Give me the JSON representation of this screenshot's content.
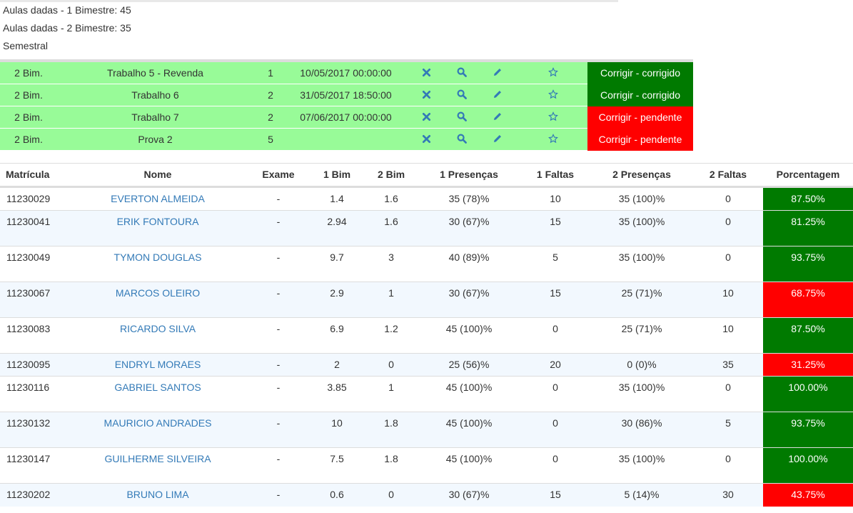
{
  "summary": {
    "line1": "Aulas dadas - 1 Bimestre: 45",
    "line2": "Aulas dadas - 2 Bimestre: 35",
    "line3": "Semestral"
  },
  "colors": {
    "activity_row_bg": "#98fb98",
    "status_ok": "#007a00",
    "status_pending": "#ff0000",
    "link": "#337ab7",
    "icon": "#337ab7"
  },
  "activities": [
    {
      "bimestre": "2 Bim.",
      "name": "Trabalho 5 - Revenda",
      "weight": "1",
      "date": "10/05/2017 00:00:00",
      "status": "Corrigir - corrigido",
      "status_type": "ok"
    },
    {
      "bimestre": "2 Bim.",
      "name": "Trabalho 6",
      "weight": "2",
      "date": "31/05/2017 18:50:00",
      "status": "Corrigir - corrigido",
      "status_type": "ok"
    },
    {
      "bimestre": "2 Bim.",
      "name": "Trabalho 7",
      "weight": "2",
      "date": "07/06/2017 00:00:00",
      "status": "Corrigir - pendente",
      "status_type": "pending"
    },
    {
      "bimestre": "2 Bim.",
      "name": "Prova 2",
      "weight": "5",
      "date": "",
      "status": "Corrigir - pendente",
      "status_type": "pending"
    }
  ],
  "activity_icons": [
    "close-icon",
    "search-icon",
    "pencil-icon",
    "star-icon"
  ],
  "students_table": {
    "headers": [
      "Matrícula",
      "Nome",
      "Exame",
      "1 Bim",
      "2 Bim",
      "1 Presenças",
      "1 Faltas",
      "2 Presenças",
      "2 Faltas",
      "Porcentagem"
    ],
    "rows": [
      {
        "matricula": "11230029",
        "nome": "EVERTON ALMEIDA",
        "exame": "-",
        "bim1": "1.4",
        "bim2": "1.6",
        "pres1": "35 (78)%",
        "faltas1": "10",
        "pres2": "35 (100)%",
        "faltas2": "0",
        "porcentagem": "87.50%",
        "status": "good"
      },
      {
        "matricula": "11230041",
        "nome": "ERIK FONTOURA",
        "exame": "-",
        "bim1": "2.94",
        "bim2": "1.6",
        "pres1": "30 (67)%",
        "faltas1": "15",
        "pres2": "35 (100)%",
        "faltas2": "0",
        "porcentagem": "81.25%",
        "status": "good"
      },
      {
        "matricula": "11230049",
        "nome": "TYMON DOUGLAS",
        "exame": "-",
        "bim1": "9.7",
        "bim2": "3",
        "pres1": "40 (89)%",
        "faltas1": "5",
        "pres2": "35 (100)%",
        "faltas2": "0",
        "porcentagem": "93.75%",
        "status": "good"
      },
      {
        "matricula": "11230067",
        "nome": "MARCOS OLEIRO",
        "exame": "-",
        "bim1": "2.9",
        "bim2": "1",
        "pres1": "30 (67)%",
        "faltas1": "15",
        "pres2": "25 (71)%",
        "faltas2": "10",
        "porcentagem": "68.75%",
        "status": "bad"
      },
      {
        "matricula": "11230083",
        "nome": "RICARDO SILVA",
        "exame": "-",
        "bim1": "6.9",
        "bim2": "1.2",
        "pres1": "45 (100)%",
        "faltas1": "0",
        "pres2": "25 (71)%",
        "faltas2": "10",
        "porcentagem": "87.50%",
        "status": "good"
      },
      {
        "matricula": "11230095",
        "nome": "ENDRYL MORAES",
        "exame": "-",
        "bim1": "2",
        "bim2": "0",
        "pres1": "25 (56)%",
        "faltas1": "20",
        "pres2": "0 (0)%",
        "faltas2": "35",
        "porcentagem": "31.25%",
        "status": "bad"
      },
      {
        "matricula": "11230116",
        "nome": "GABRIEL SANTOS",
        "exame": "-",
        "bim1": "3.85",
        "bim2": "1",
        "pres1": "45 (100)%",
        "faltas1": "0",
        "pres2": "35 (100)%",
        "faltas2": "0",
        "porcentagem": "100.00%",
        "status": "good"
      },
      {
        "matricula": "11230132",
        "nome": "MAURICIO ANDRADES",
        "exame": "-",
        "bim1": "10",
        "bim2": "1.8",
        "pres1": "45 (100)%",
        "faltas1": "0",
        "pres2": "30 (86)%",
        "faltas2": "5",
        "porcentagem": "93.75%",
        "status": "good"
      },
      {
        "matricula": "11230147",
        "nome": "GUILHERME SILVEIRA",
        "exame": "-",
        "bim1": "7.5",
        "bim2": "1.8",
        "pres1": "45 (100)%",
        "faltas1": "0",
        "pres2": "35 (100)%",
        "faltas2": "0",
        "porcentagem": "100.00%",
        "status": "good"
      },
      {
        "matricula": "11230202",
        "nome": "BRUNO LIMA",
        "exame": "-",
        "bim1": "0.6",
        "bim2": "0",
        "pres1": "30 (67)%",
        "faltas1": "15",
        "pres2": "5 (14)%",
        "faltas2": "30",
        "porcentagem": "43.75%",
        "status": "bad"
      }
    ]
  }
}
